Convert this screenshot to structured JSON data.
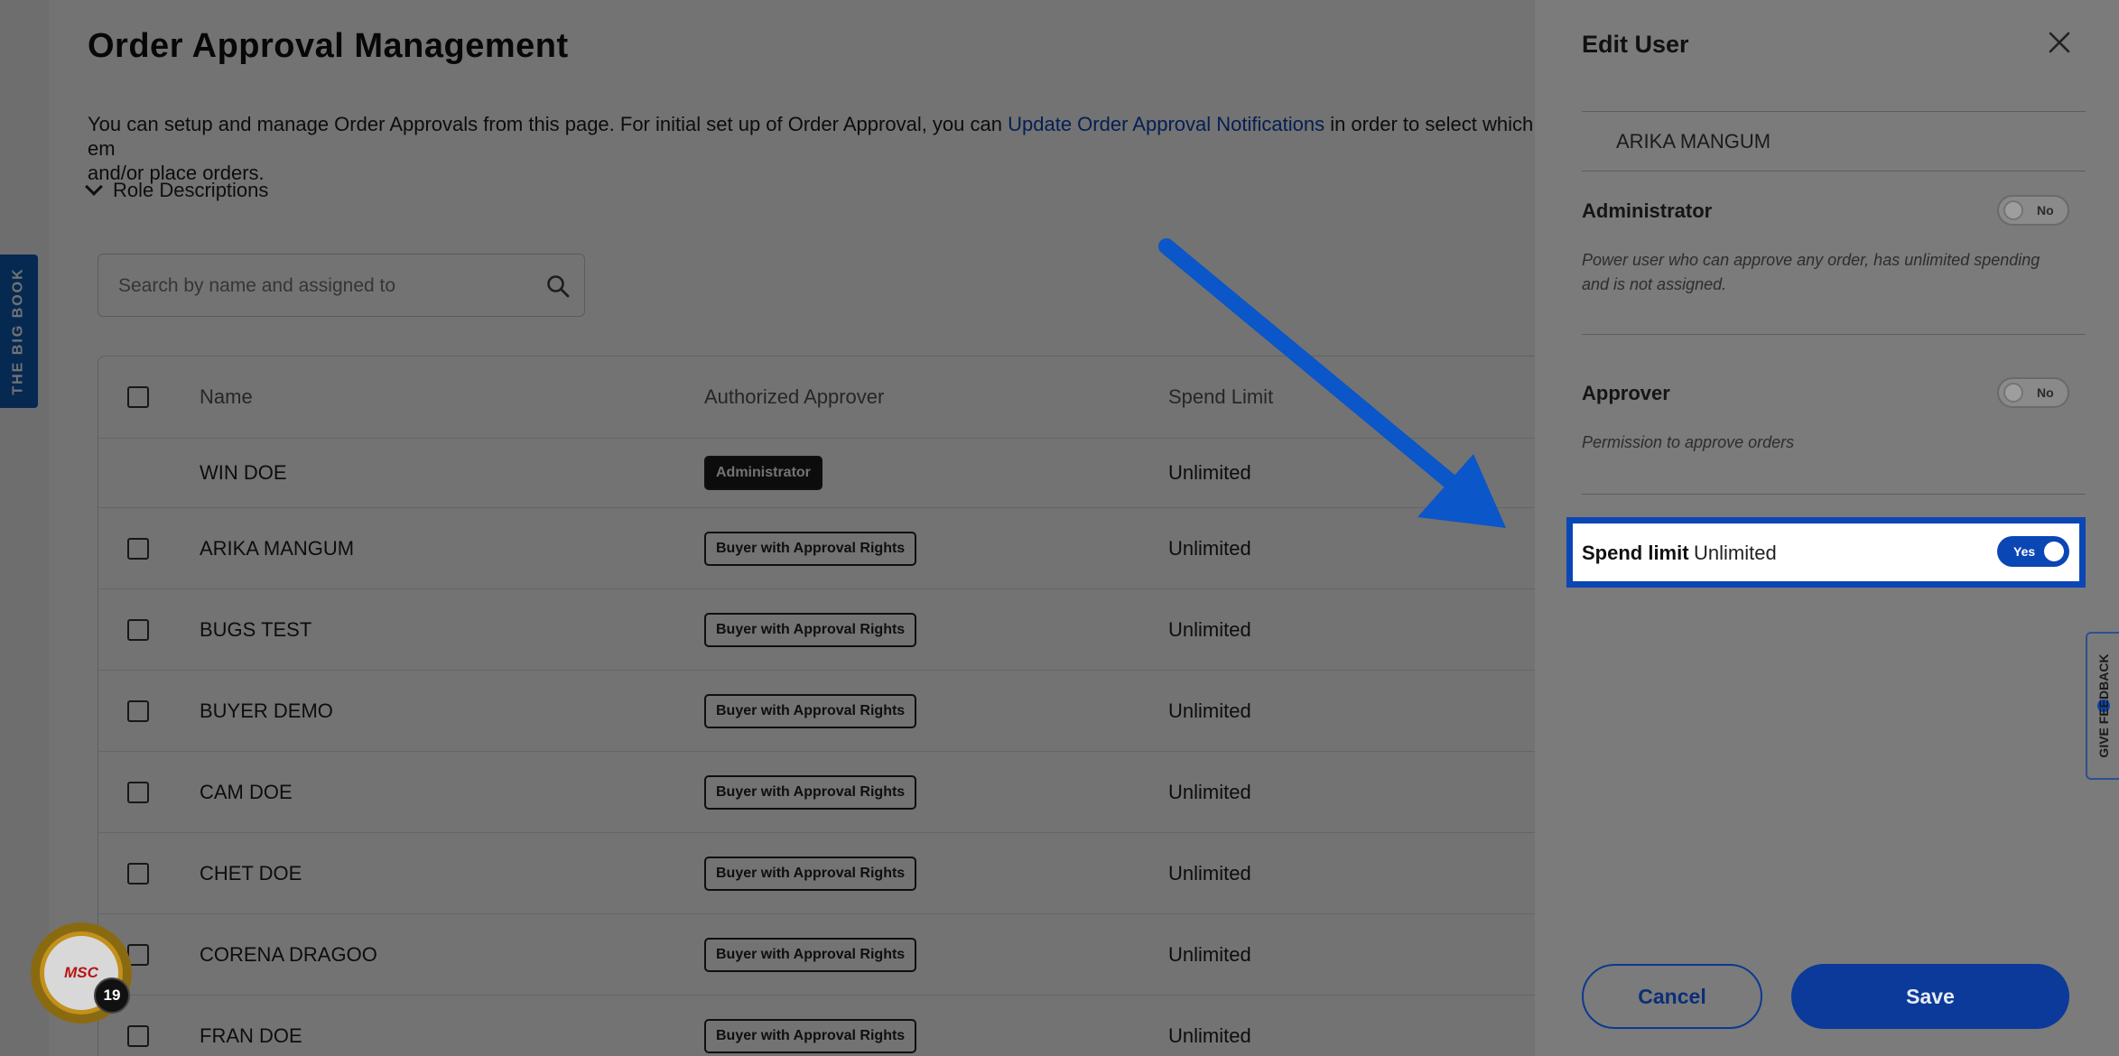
{
  "side_tab": {
    "label": "THE BIG BOOK"
  },
  "page": {
    "title": "Order Approval Management",
    "intro_before": "You can setup and manage Order Approvals from this page. For initial set up of Order Approval, you can ",
    "intro_link": "Update Order Approval Notifications",
    "intro_after": " in order to select which em",
    "intro_line2": "and/or place orders.",
    "role_descriptions": "Role Descriptions"
  },
  "search": {
    "placeholder": "Search by name and assigned to",
    "icon": "search-icon"
  },
  "table": {
    "headers": {
      "name": "Name",
      "approver": "Authorized Approver",
      "spend": "Spend Limit"
    },
    "rows": [
      {
        "name": "WIN DOE",
        "role": "Administrator",
        "spend": "Unlimited",
        "checkbox": false
      },
      {
        "name": "ARIKA MANGUM",
        "role": "Buyer with Approval Rights",
        "spend": "Unlimited",
        "checkbox": true
      },
      {
        "name": "BUGS TEST",
        "role": "Buyer with Approval Rights",
        "spend": "Unlimited",
        "checkbox": true
      },
      {
        "name": "BUYER DEMO",
        "role": "Buyer with Approval Rights",
        "spend": "Unlimited",
        "checkbox": true
      },
      {
        "name": "CAM DOE",
        "role": "Buyer with Approval Rights",
        "spend": "Unlimited",
        "checkbox": true
      },
      {
        "name": "CHET DOE",
        "role": "Buyer with Approval Rights",
        "spend": "Unlimited",
        "checkbox": true
      },
      {
        "name": "CORENA DRAGOO",
        "role": "Buyer with Approval Rights",
        "spend": "Unlimited",
        "checkbox": true
      },
      {
        "name": "FRAN DOE",
        "role": "Buyer with Approval Rights",
        "spend": "Unlimited",
        "checkbox": true
      }
    ]
  },
  "msc_badge": {
    "logo": "MSC",
    "count": "19"
  },
  "drawer": {
    "title": "Edit User",
    "user_name": "ARIKA MANGUM",
    "administrator": {
      "label": "Administrator",
      "toggle": "No",
      "description": "Power user who can approve any order, has unlimited spending and is not assigned."
    },
    "approver": {
      "label": "Approver",
      "toggle": "No",
      "description": "Permission to approve orders"
    },
    "spend_limit": {
      "label": "Spend limit",
      "value": "Unlimited",
      "toggle": "Yes"
    },
    "cancel": "Cancel",
    "save": "Save"
  },
  "feedback": {
    "label": "GIVE FEEDBACK"
  },
  "colors": {
    "accent": "#0b46b5",
    "arrow": "#0b56c8"
  }
}
